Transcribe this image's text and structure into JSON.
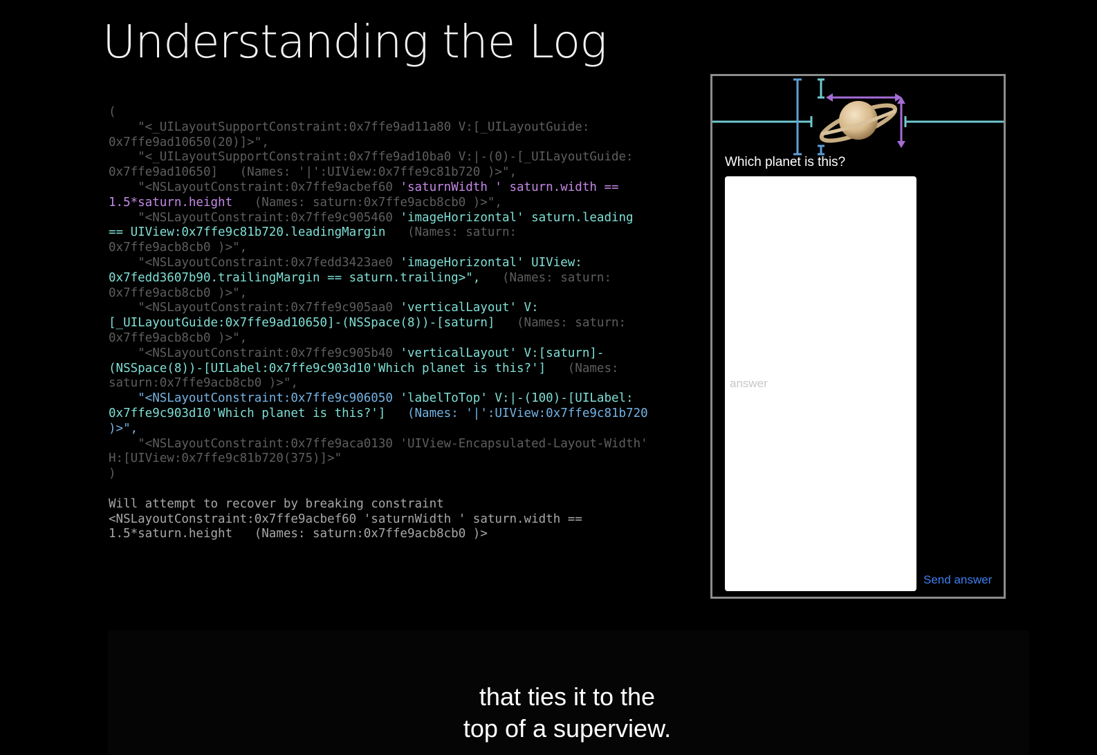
{
  "slide": {
    "title": "Understanding the Log"
  },
  "log": {
    "lines": [
      [
        {
          "s": "g",
          "t": "("
        }
      ],
      [
        {
          "s": "g",
          "t": "    \"<_UILayoutSupportConstraint:0x7ffe9ad11a80 V:[_UILayoutGuide:"
        }
      ],
      [
        {
          "s": "g",
          "t": "0x7ffe9ad10650(20)]>\","
        }
      ],
      [
        {
          "s": "g",
          "t": "    \"<_UILayoutSupportConstraint:0x7ffe9ad10ba0 V:|-(0)-[_UILayoutGuide:"
        }
      ],
      [
        {
          "s": "g",
          "t": "0x7ffe9ad10650]   (Names: '|':UIView:0x7ffe9c81b720 )>\","
        }
      ],
      [
        {
          "s": "g",
          "t": "    \"<NSLayoutConstraint:0x7ffe9acbef60 "
        },
        {
          "s": "p",
          "t": "'saturnWidth ' saturn.width =="
        }
      ],
      [
        {
          "s": "p",
          "t": "1.5*saturn.height"
        },
        {
          "s": "g",
          "t": "   (Names: saturn:0x7ffe9acb8cb0 )>\","
        }
      ],
      [
        {
          "s": "g",
          "t": "    \"<NSLayoutConstraint:0x7ffe9c905460 "
        },
        {
          "s": "t",
          "t": "'imageHorizontal' saturn.leading"
        }
      ],
      [
        {
          "s": "t",
          "t": "== UIView:0x7ffe9c81b720.leadingMargin"
        },
        {
          "s": "g",
          "t": "   (Names: saturn:"
        }
      ],
      [
        {
          "s": "g",
          "t": "0x7ffe9acb8cb0 )>\","
        }
      ],
      [
        {
          "s": "g",
          "t": "    \"<NSLayoutConstraint:0x7fedd3423ae0 "
        },
        {
          "s": "t",
          "t": "'imageHorizontal' UIView:"
        }
      ],
      [
        {
          "s": "t",
          "t": "0x7fedd3607b90.trailingMargin == saturn.trailing>\","
        },
        {
          "s": "g",
          "t": "   (Names: saturn:"
        }
      ],
      [
        {
          "s": "g",
          "t": "0x7ffe9acb8cb0 )>\","
        }
      ],
      [
        {
          "s": "g",
          "t": "    \"<NSLayoutConstraint:0x7ffe9c905aa0 "
        },
        {
          "s": "t",
          "t": "'verticalLayout' V:"
        }
      ],
      [
        {
          "s": "t",
          "t": "[_UILayoutGuide:0x7ffe9ad10650]-(NSSpace(8))-[saturn]"
        },
        {
          "s": "g",
          "t": "   (Names: saturn:"
        }
      ],
      [
        {
          "s": "g",
          "t": "0x7ffe9acb8cb0 )>\","
        }
      ],
      [
        {
          "s": "g",
          "t": "    \"<NSLayoutConstraint:0x7ffe9c905b40 "
        },
        {
          "s": "t",
          "t": "'verticalLayout' V:[saturn]-"
        }
      ],
      [
        {
          "s": "t",
          "t": "(NSSpace(8))-[UILabel:0x7ffe9c903d10'Which planet is this?']"
        },
        {
          "s": "g",
          "t": "   (Names:"
        }
      ],
      [
        {
          "s": "g",
          "t": "saturn:0x7ffe9acb8cb0 )>\","
        }
      ],
      [
        {
          "s": "b",
          "t": "    \"<NSLayoutConstraint:0x7ffe9c906050 "
        },
        {
          "s": "t",
          "t": "'labelToTop' V:|-(100)-[UILabel:"
        }
      ],
      [
        {
          "s": "t",
          "t": "0x7ffe9c903d10'Which planet is this?']"
        },
        {
          "s": "b",
          "t": "   (Names: '|':UIView:0x7ffe9c81b720"
        }
      ],
      [
        {
          "s": "b",
          "t": ")>\","
        }
      ],
      [
        {
          "s": "g",
          "t": "    \"<NSLayoutConstraint:0x7ffe9aca0130 'UIView-Encapsulated-Layout-Width'"
        }
      ],
      [
        {
          "s": "g",
          "t": "H:[UIView:0x7ffe9c81b720(375)]>\""
        }
      ],
      [
        {
          "s": "g",
          "t": ")"
        }
      ],
      [
        {
          "s": "g",
          "t": ""
        }
      ],
      [
        {
          "s": "w",
          "t": "Will attempt to recover by breaking constraint"
        }
      ],
      [
        {
          "s": "w",
          "t": "<NSLayoutConstraint:0x7ffe9acbef60 'saturnWidth ' saturn.width =="
        }
      ],
      [
        {
          "s": "w",
          "t": "1.5*saturn.height   (Names: saturn:0x7ffe9acb8cb0 )>"
        }
      ]
    ]
  },
  "device": {
    "question": "Which planet is this?",
    "answer_placeholder": "answer",
    "send_label": "Send answer",
    "planet_icon": "saturn-icon",
    "colors": {
      "accent": "#3d7ef0",
      "guide_teal": "#6fc9d0",
      "guide_purple": "#a56cd6",
      "guide_blue": "#5e9fd6"
    }
  },
  "caption": {
    "line1": "that ties it to the",
    "line2": "top of a superview."
  }
}
